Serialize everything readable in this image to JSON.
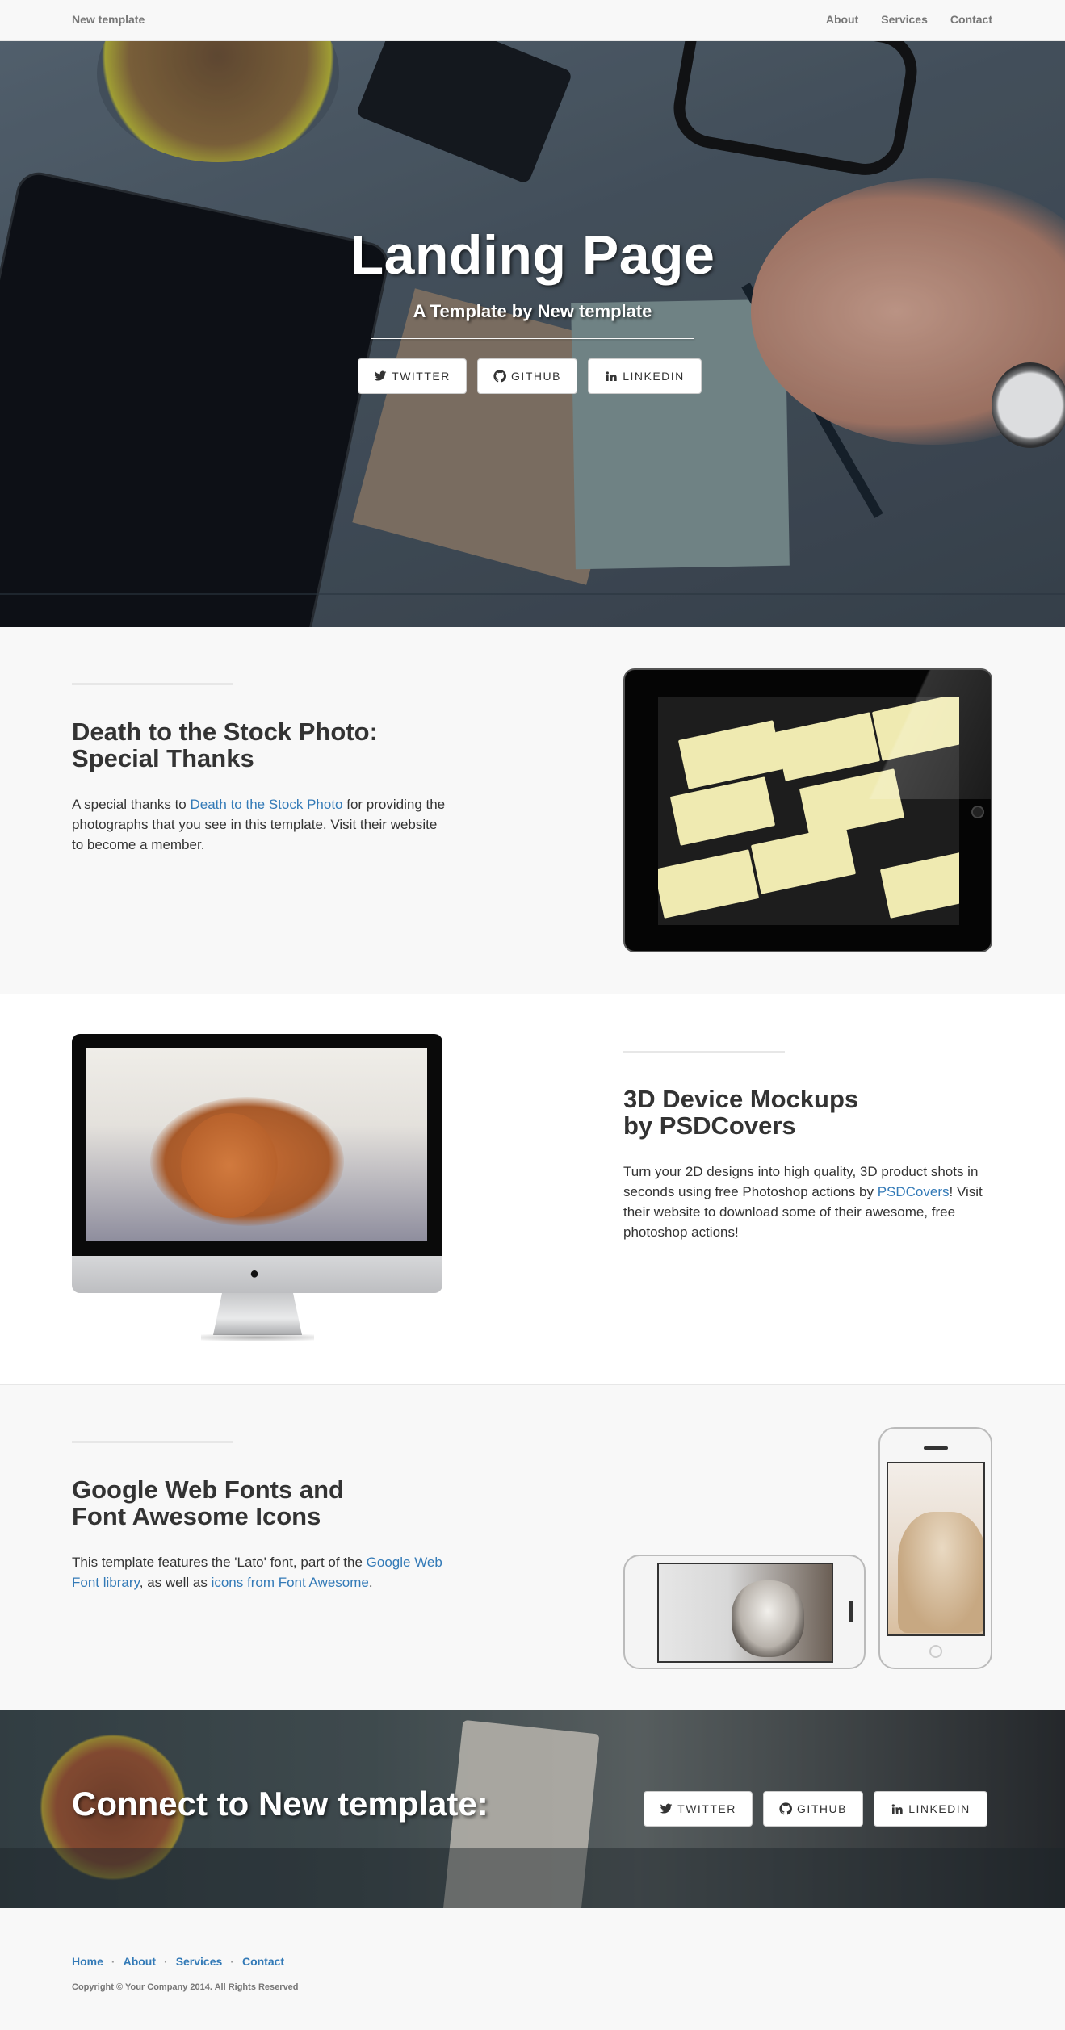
{
  "navbar": {
    "brand": "New template",
    "links": [
      "About",
      "Services",
      "Contact"
    ]
  },
  "hero": {
    "title": "Landing Page",
    "subtitle": "A Template by New template",
    "buttons": {
      "twitter": "Twitter",
      "github": "Github",
      "linkedin": "Linkedin"
    }
  },
  "section_a": {
    "heading_line1": "Death to the Stock Photo:",
    "heading_line2": "Special Thanks",
    "body_pre": "A special thanks to ",
    "body_link": "Death to the Stock Photo",
    "body_post": " for providing the photographs that you see in this template. Visit their website to become a member."
  },
  "section_b": {
    "heading_line1": "3D Device Mockups",
    "heading_line2": "by PSDCovers",
    "body_pre": "Turn your 2D designs into high quality, 3D product shots in seconds using free Photoshop actions by ",
    "body_link": "PSDCovers",
    "body_post": "! Visit their website to download some of their awesome, free photoshop actions!"
  },
  "section_c": {
    "heading_line1": "Google Web Fonts and",
    "heading_line2": "Font Awesome Icons",
    "body_pre": "This template features the 'Lato' font, part of the ",
    "body_link1": "Google Web Font library",
    "body_mid": ", as well as ",
    "body_link2": "icons from Font Awesome",
    "body_post": "."
  },
  "banner": {
    "title": "Connect to New template:",
    "buttons": {
      "twitter": "Twitter",
      "github": "Github",
      "linkedin": "Linkedin"
    }
  },
  "footer": {
    "links": [
      "Home",
      "About",
      "Services",
      "Contact"
    ],
    "separator": "·",
    "copyright": "Copyright © Your Company 2014. All Rights Reserved"
  },
  "icons": {
    "twitter": "twitter-icon",
    "github": "github-icon",
    "linkedin": "linkedin-icon",
    "apple": "apple-logo-icon"
  },
  "colors": {
    "link": "#337ab7",
    "navbar_bg": "#f8f8f8",
    "text": "#333333"
  }
}
